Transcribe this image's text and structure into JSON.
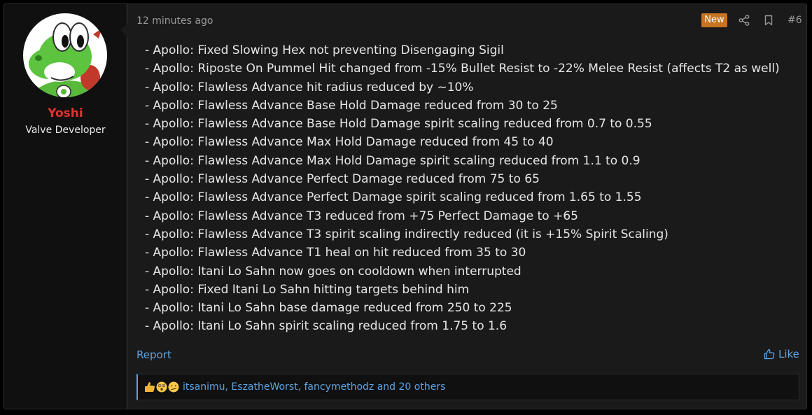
{
  "user": {
    "name": "Yoshi",
    "title": "Valve Developer"
  },
  "post": {
    "time": "12 minutes ago",
    "badge": "New",
    "number": "#6",
    "lines": [
      "- Apollo: Fixed Slowing Hex not preventing Disengaging Sigil",
      "- Apollo: Riposte On Pummel Hit changed from -15% Bullet Resist to -22% Melee Resist (affects T2 as well)",
      "- Apollo: Flawless Advance hit radius reduced by ~10%",
      "- Apollo: Flawless Advance Base Hold Damage reduced from 30 to 25",
      "- Apollo: Flawless Advance Base Hold Damage spirit scaling reduced from 0.7 to 0.55",
      "- Apollo: Flawless Advance Max Hold Damage reduced from 45 to 40",
      "- Apollo: Flawless Advance Max Hold Damage spirit scaling reduced from 1.1 to 0.9",
      "- Apollo: Flawless Advance Perfect Damage reduced from 75 to 65",
      "- Apollo: Flawless Advance Perfect Damage spirit scaling reduced from 1.65 to 1.55",
      "- Apollo: Flawless Advance T3 reduced from +75 Perfect Damage to +65",
      "- Apollo: Flawless Advance T3 spirit scaling indirectly reduced (it is +15% Spirit Scaling)",
      "- Apollo: Flawless Advance T1 heal on hit reduced from 35 to 30",
      "- Apollo: Itani Lo Sahn now goes on cooldown when interrupted",
      "- Apollo: Fixed Itani Lo Sahn hitting targets behind him",
      "- Apollo: Itani Lo Sahn base damage reduced from 250 to 225",
      "- Apollo: Itani Lo Sahn spirit scaling reduced from 1.75 to 1.6"
    ]
  },
  "actions": {
    "report": "Report",
    "like": "Like"
  },
  "reactions": {
    "text": "itsanimu, EszatheWorst, fancymethodz and 20 others",
    "icons": [
      "thumbs-up-icon",
      "wow-face-icon",
      "confused-face-icon"
    ]
  },
  "colors": {
    "accent": "#5ea3e0",
    "username": "#e03232",
    "badge": "#c8731f"
  }
}
